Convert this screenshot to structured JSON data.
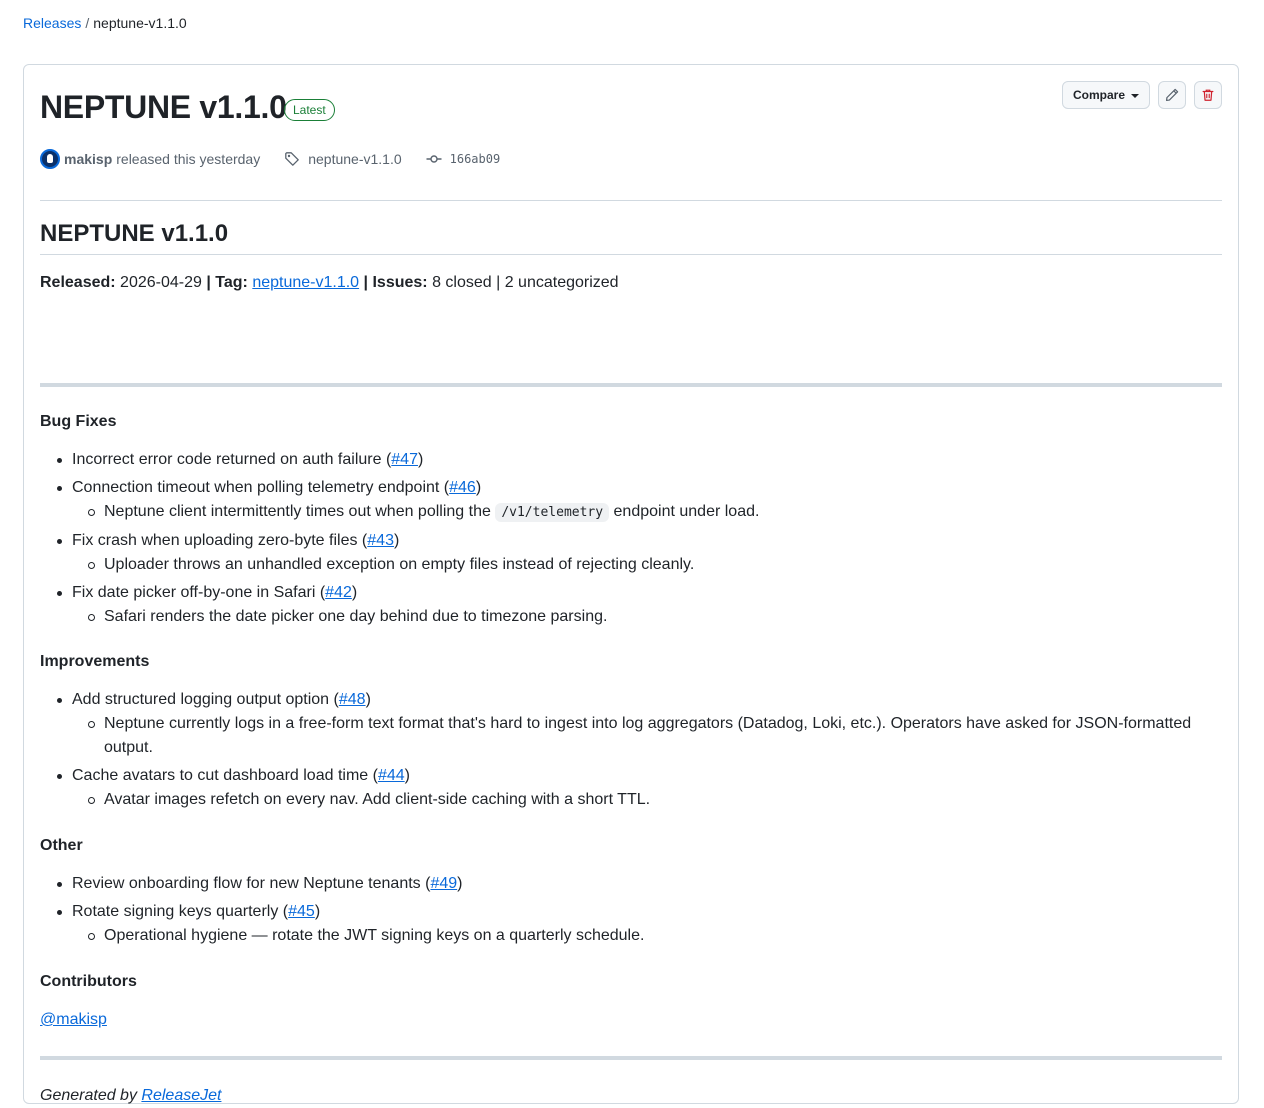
{
  "breadcrumb": {
    "root": "Releases",
    "separator": "/",
    "current": "neptune-v1.1.0"
  },
  "release": {
    "title": "NEPTUNE v1.1.0",
    "badge": "Latest",
    "author": "makisp",
    "released_text": "released this yesterday",
    "tag": "neptune-v1.1.0",
    "commit": "166ab09"
  },
  "actions": {
    "compare": "Compare",
    "edit_icon": "pencil-icon",
    "delete_icon": "trash-icon"
  },
  "notes": {
    "heading": "NEPTUNE v1.1.0",
    "summary": {
      "released_label": "Released:",
      "released_value": "2026-04-29",
      "sep1": "|",
      "tag_label": "Tag:",
      "tag_value": "neptune-v1.1.0",
      "sep2": "|",
      "issues_label": "Issues:",
      "issues_value": "8 closed | 2 uncategorized"
    },
    "sections": [
      {
        "title": "Bug Fixes",
        "items": [
          {
            "text": "Incorrect error code returned on auth failure",
            "ref": "#47"
          },
          {
            "text": "Connection timeout when polling telemetry endpoint",
            "ref": "#46",
            "detail_pre": "Neptune client intermittently times out when polling the",
            "detail_code": "/v1/telemetry",
            "detail_post": "endpoint under load."
          },
          {
            "text": "Fix crash when uploading zero-byte files",
            "ref": "#43",
            "detail": "Uploader throws an unhandled exception on empty files instead of rejecting cleanly."
          },
          {
            "text": "Fix date picker off-by-one in Safari",
            "ref": "#42",
            "detail": "Safari renders the date picker one day behind due to timezone parsing."
          }
        ]
      },
      {
        "title": "Improvements",
        "items": [
          {
            "text": "Add structured logging output option",
            "ref": "#48",
            "detail": "Neptune currently logs in a free-form text format that's hard to ingest into log aggregators (Datadog, Loki, etc.). Operators have asked for JSON-formatted output."
          },
          {
            "text": "Cache avatars to cut dashboard load time",
            "ref": "#44",
            "detail": "Avatar images refetch on every nav. Add client-side caching with a short TTL."
          }
        ]
      },
      {
        "title": "Other",
        "items": [
          {
            "text": "Review onboarding flow for new Neptune tenants",
            "ref": "#49"
          },
          {
            "text": "Rotate signing keys quarterly",
            "ref": "#45",
            "detail": "Operational hygiene — rotate the JWT signing keys on a quarterly schedule."
          }
        ]
      },
      {
        "title": "Contributors"
      }
    ],
    "contributor": "@makisp",
    "footer_prefix": "Generated by",
    "footer_link": "ReleaseJet"
  }
}
